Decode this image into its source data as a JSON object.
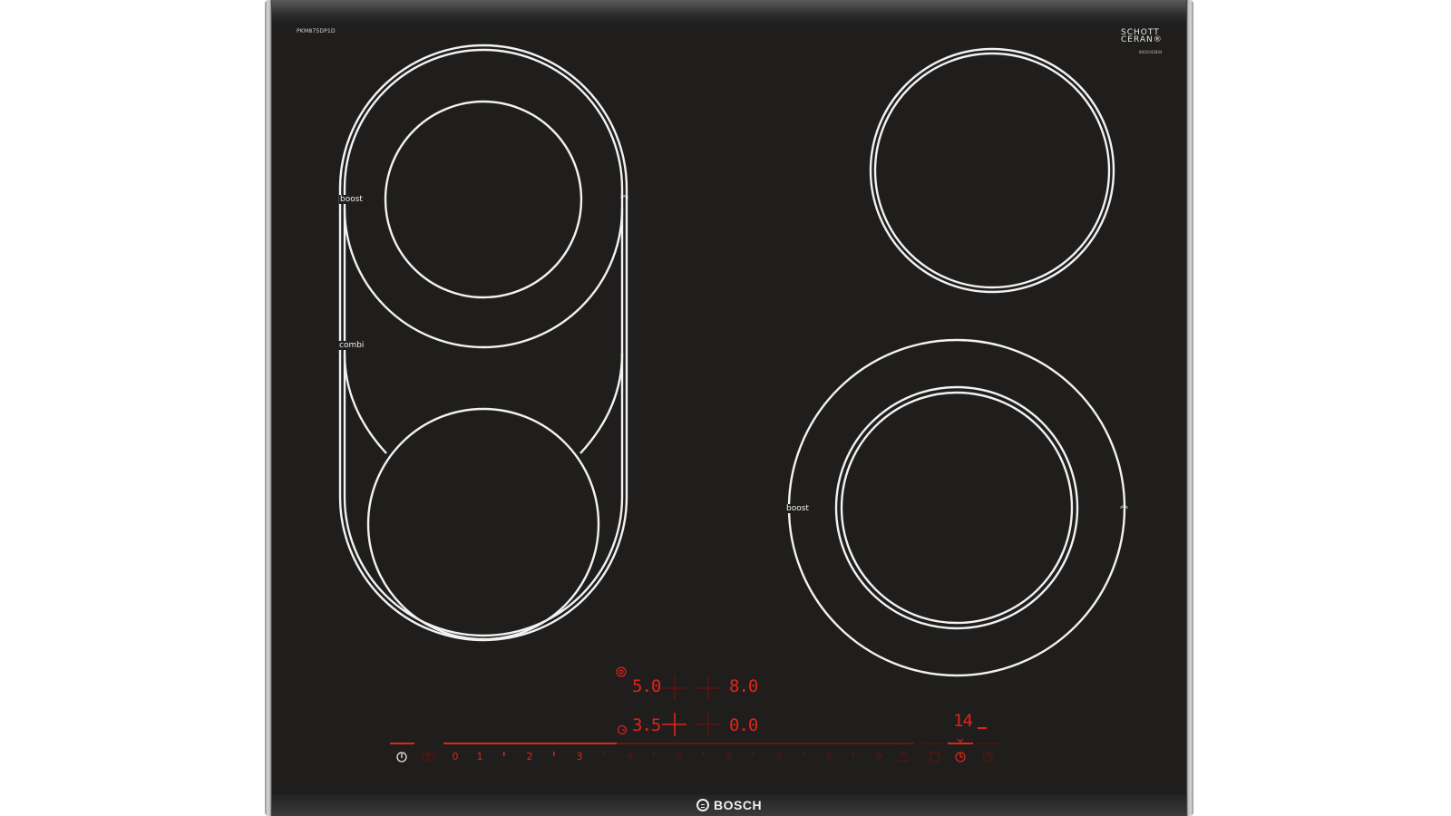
{
  "hob": {
    "model_label": "PKM875DP1D",
    "schott_logo": "SCHOTT CERAN®",
    "schott_sub": "8001042844",
    "brand": "BOSCH"
  },
  "zones": {
    "left_boost_label": "boost",
    "left_combi_label": "combi",
    "right_boost_label": "boost",
    "boost_icon": "double-chevron-up-icon"
  },
  "displays": {
    "top_left_value": "5.0",
    "top_right_value": "8.0",
    "bottom_left_value": "3.5",
    "bottom_right_value": "0.0",
    "timer_value": "14"
  },
  "slider": {
    "numbers": [
      "0",
      "1",
      "2",
      "3",
      "4",
      "5",
      "6",
      "7",
      "8",
      "9"
    ],
    "active_level": 3,
    "power_icon": "power-icon",
    "childlock_icon": "child-lock-icon",
    "boost_icon": "boost-icon",
    "cooktop_timer_icon": "cooktop-timer-icon",
    "timer_icon": "timer-icon",
    "stopwatch_icon": "stopwatch-icon"
  },
  "colors": {
    "glass": "#1f1e1d",
    "ring": "#f2f2f2",
    "display_red": "#e2231a"
  }
}
